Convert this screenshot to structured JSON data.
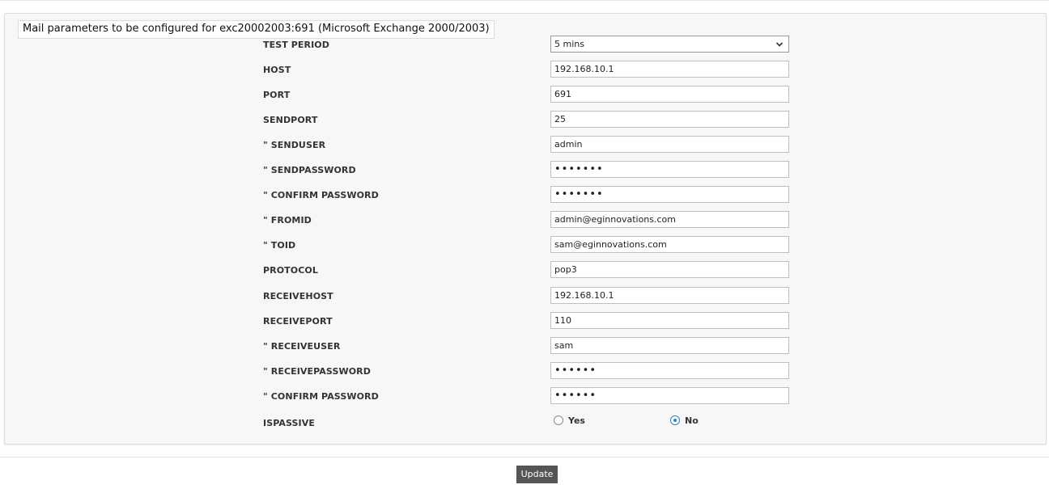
{
  "panel": {
    "legend": "Mail parameters to be configured for exc20002003:691 (Microsoft Exchange 2000/2003)"
  },
  "fields": {
    "test_period": {
      "label": "TEST PERIOD",
      "value": "5 mins"
    },
    "host": {
      "label": "HOST",
      "value": "192.168.10.1"
    },
    "port": {
      "label": "PORT",
      "value": "691"
    },
    "sendport": {
      "label": "SENDPORT",
      "value": "25"
    },
    "senduser": {
      "label": "\" SENDUSER",
      "value": "admin"
    },
    "sendpassword": {
      "label": "\" SENDPASSWORD",
      "value": "•••••••"
    },
    "confirm_password_1": {
      "label": "\" CONFIRM PASSWORD",
      "value": "•••••••"
    },
    "fromid": {
      "label": "\" FROMID",
      "value": "admin@eginnovations.com"
    },
    "toid": {
      "label": "\" TOID",
      "value": "sam@eginnovations.com"
    },
    "protocol": {
      "label": "PROTOCOL",
      "value": "pop3"
    },
    "receivehost": {
      "label": "RECEIVEHOST",
      "value": "192.168.10.1"
    },
    "receiveport": {
      "label": "RECEIVEPORT",
      "value": "110"
    },
    "receiveuser": {
      "label": "\" RECEIVEUSER",
      "value": "sam"
    },
    "receivepassword": {
      "label": "\" RECEIVEPASSWORD",
      "value": "••••••"
    },
    "confirm_password_2": {
      "label": "\" CONFIRM PASSWORD",
      "value": "••••••"
    },
    "ispassive": {
      "label": "ISPASSIVE",
      "options": [
        "Yes",
        "No"
      ],
      "selected": "No"
    }
  },
  "actions": {
    "update_label": "Update"
  },
  "colors": {
    "radio_accent": "#2f7fb8",
    "button_bg": "#555555"
  }
}
